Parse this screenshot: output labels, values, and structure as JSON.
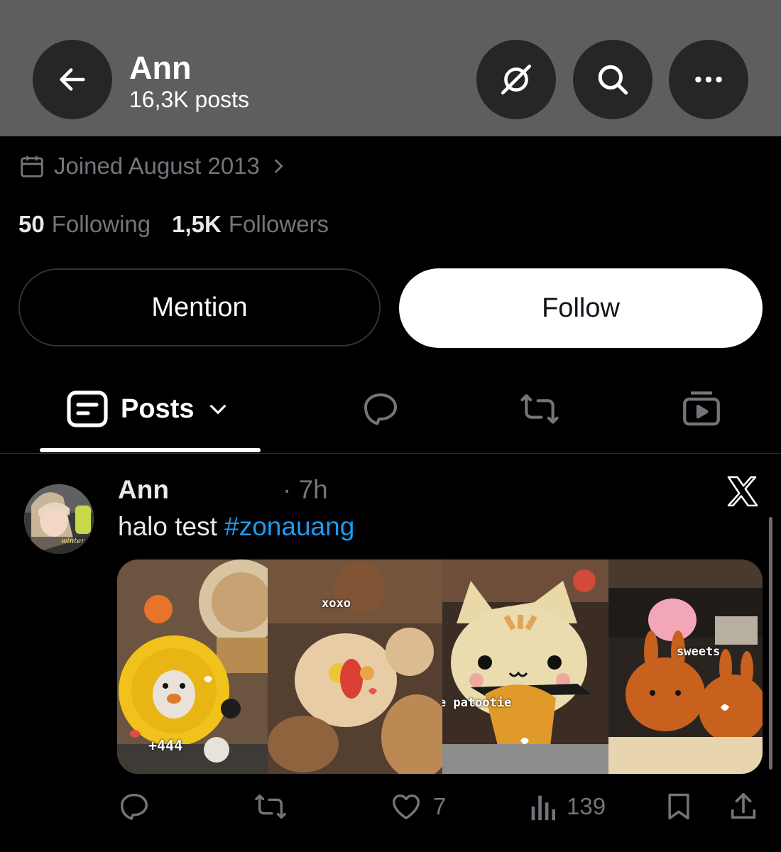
{
  "header": {
    "name": "Ann",
    "post_count": "16,3K posts"
  },
  "profile": {
    "joined": "Joined August 2013",
    "following_count": "50",
    "following_label": "Following",
    "followers_count": "1,5K",
    "followers_label": "Followers",
    "mention_label": "Mention",
    "follow_label": "Follow"
  },
  "tabs": {
    "posts_label": "Posts"
  },
  "tweet": {
    "author": "Ann",
    "time": "· 7h",
    "text": "halo test ",
    "hashtag": "#zonauang",
    "avatar_overlay": "winter",
    "images": [
      {
        "overlay": "+444"
      },
      {
        "overlay": "xoxo"
      },
      {
        "overlay": "cutie patootie"
      },
      {
        "overlay": "sweets"
      }
    ],
    "likes": "7",
    "views": "139"
  },
  "icons": {
    "back": "arrow-left-icon",
    "grok": "grok-icon",
    "search": "search-icon",
    "more": "more-icon",
    "calendar": "calendar-icon",
    "chevron": "chevron-right-icon",
    "x_logo": "x-logo-icon"
  },
  "colors": {
    "accent": "#1d9bf0",
    "background": "#000000",
    "header": "#5e5e5e",
    "muted": "#71767b"
  }
}
